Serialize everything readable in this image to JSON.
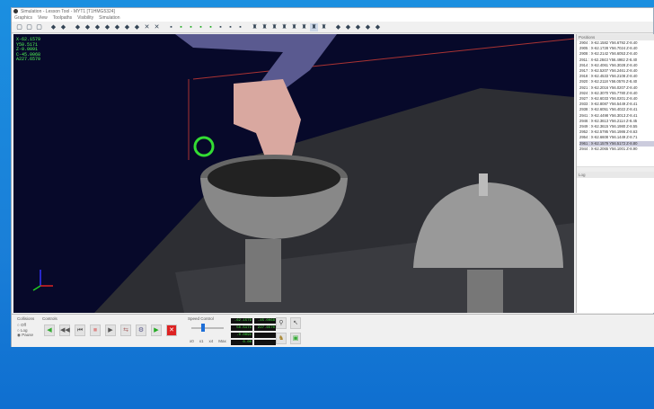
{
  "window": {
    "title": "Simulation - Lesson Tool - MYT1 [T1HMG5324]"
  },
  "menu": [
    "Graphics",
    "View",
    "Toolpaths",
    "Visibility",
    "Simulation"
  ],
  "toolbar_icons": [
    "single-view",
    "split-view",
    "quad-view",
    "pointer",
    "zoom",
    "tool-1",
    "tool-2",
    "tool-3",
    "tool-4",
    "tool-5",
    "tool-6",
    "tool-7",
    "close-x",
    "close-x2",
    "layer-1",
    "layer-2",
    "layer-3",
    "layer-4",
    "layer-5",
    "layer-6",
    "layer-7",
    "layer-8",
    "machine-1",
    "machine-2",
    "machine-3",
    "machine-4",
    "machine-5",
    "machine-6",
    "machine-7",
    "machine-8",
    "search",
    "pointer-2",
    "settings",
    "person",
    "gear"
  ],
  "coords": [
    "X-62.1579",
    "Y50.5171",
    "Z-0.0091",
    "C-45.0068",
    "A227.6570"
  ],
  "positions": {
    "title": "Positions",
    "items": [
      "2904 : X-62.1582 Y56.6792 Z-8.40",
      "2905 : X-62.1728 Y56.7024 Z-8.40",
      "2908 : X-62.2142 Y56.6053 Z-8.40",
      "2911 : X-62.2843 Y56.4982 Z-8.40",
      "2914 : X-62.4061 Y56.3028 Z-8.40",
      "2917 : X-62.5207 Y56.2461 Z-8.40",
      "2918 : X-62.4533 Y56.2108 Z-8.40",
      "2920 : X-62.2118 Y56.0576 Z-8.40",
      "2921 : X-62.2016 Y56.0207 Z-8.40",
      "2924 : X-62.3070 Y55.7780 Z-8.40",
      "2927 : X-62.6033 Y56.0201 Z-8.40",
      "2933 : X-62.8087 Y56.5449 Z-8.41",
      "2938 : X-62.6051 Y56.4022 Z-8.41",
      "2941 : X-62.4498 Y56.3013 Z-8.41",
      "2946 : X-62.3613 Y56.2114 Z-8.45",
      "2949 : X-62.3615 Y56.1980 Z-8.55",
      "2952 : X-62.5795 Y56.1986 Z-8.63",
      "2954 : X-62.6608 Y56.1449 Z-8.71",
      "2961 : X-62.1579 Y56.5172 Z-8.80",
      "2944 : X-62.2065 Y56.1001 Z-8.90"
    ],
    "selected": 18
  },
  "log": {
    "title": "Log"
  },
  "collisions": {
    "title": "Collisions",
    "options": [
      "Off",
      "Log",
      "Pause"
    ],
    "selected": 2
  },
  "controls": {
    "title": "Controls"
  },
  "speed": {
    "title": "Speed Control",
    "labels": [
      "x0",
      "x1",
      "x4",
      "Max"
    ],
    "value": 0.35
  },
  "displays": [
    "-62.1579",
    "-45.0068",
    "50.5171",
    "227.6570",
    "-0.0091",
    "",
    "0.00",
    ""
  ]
}
